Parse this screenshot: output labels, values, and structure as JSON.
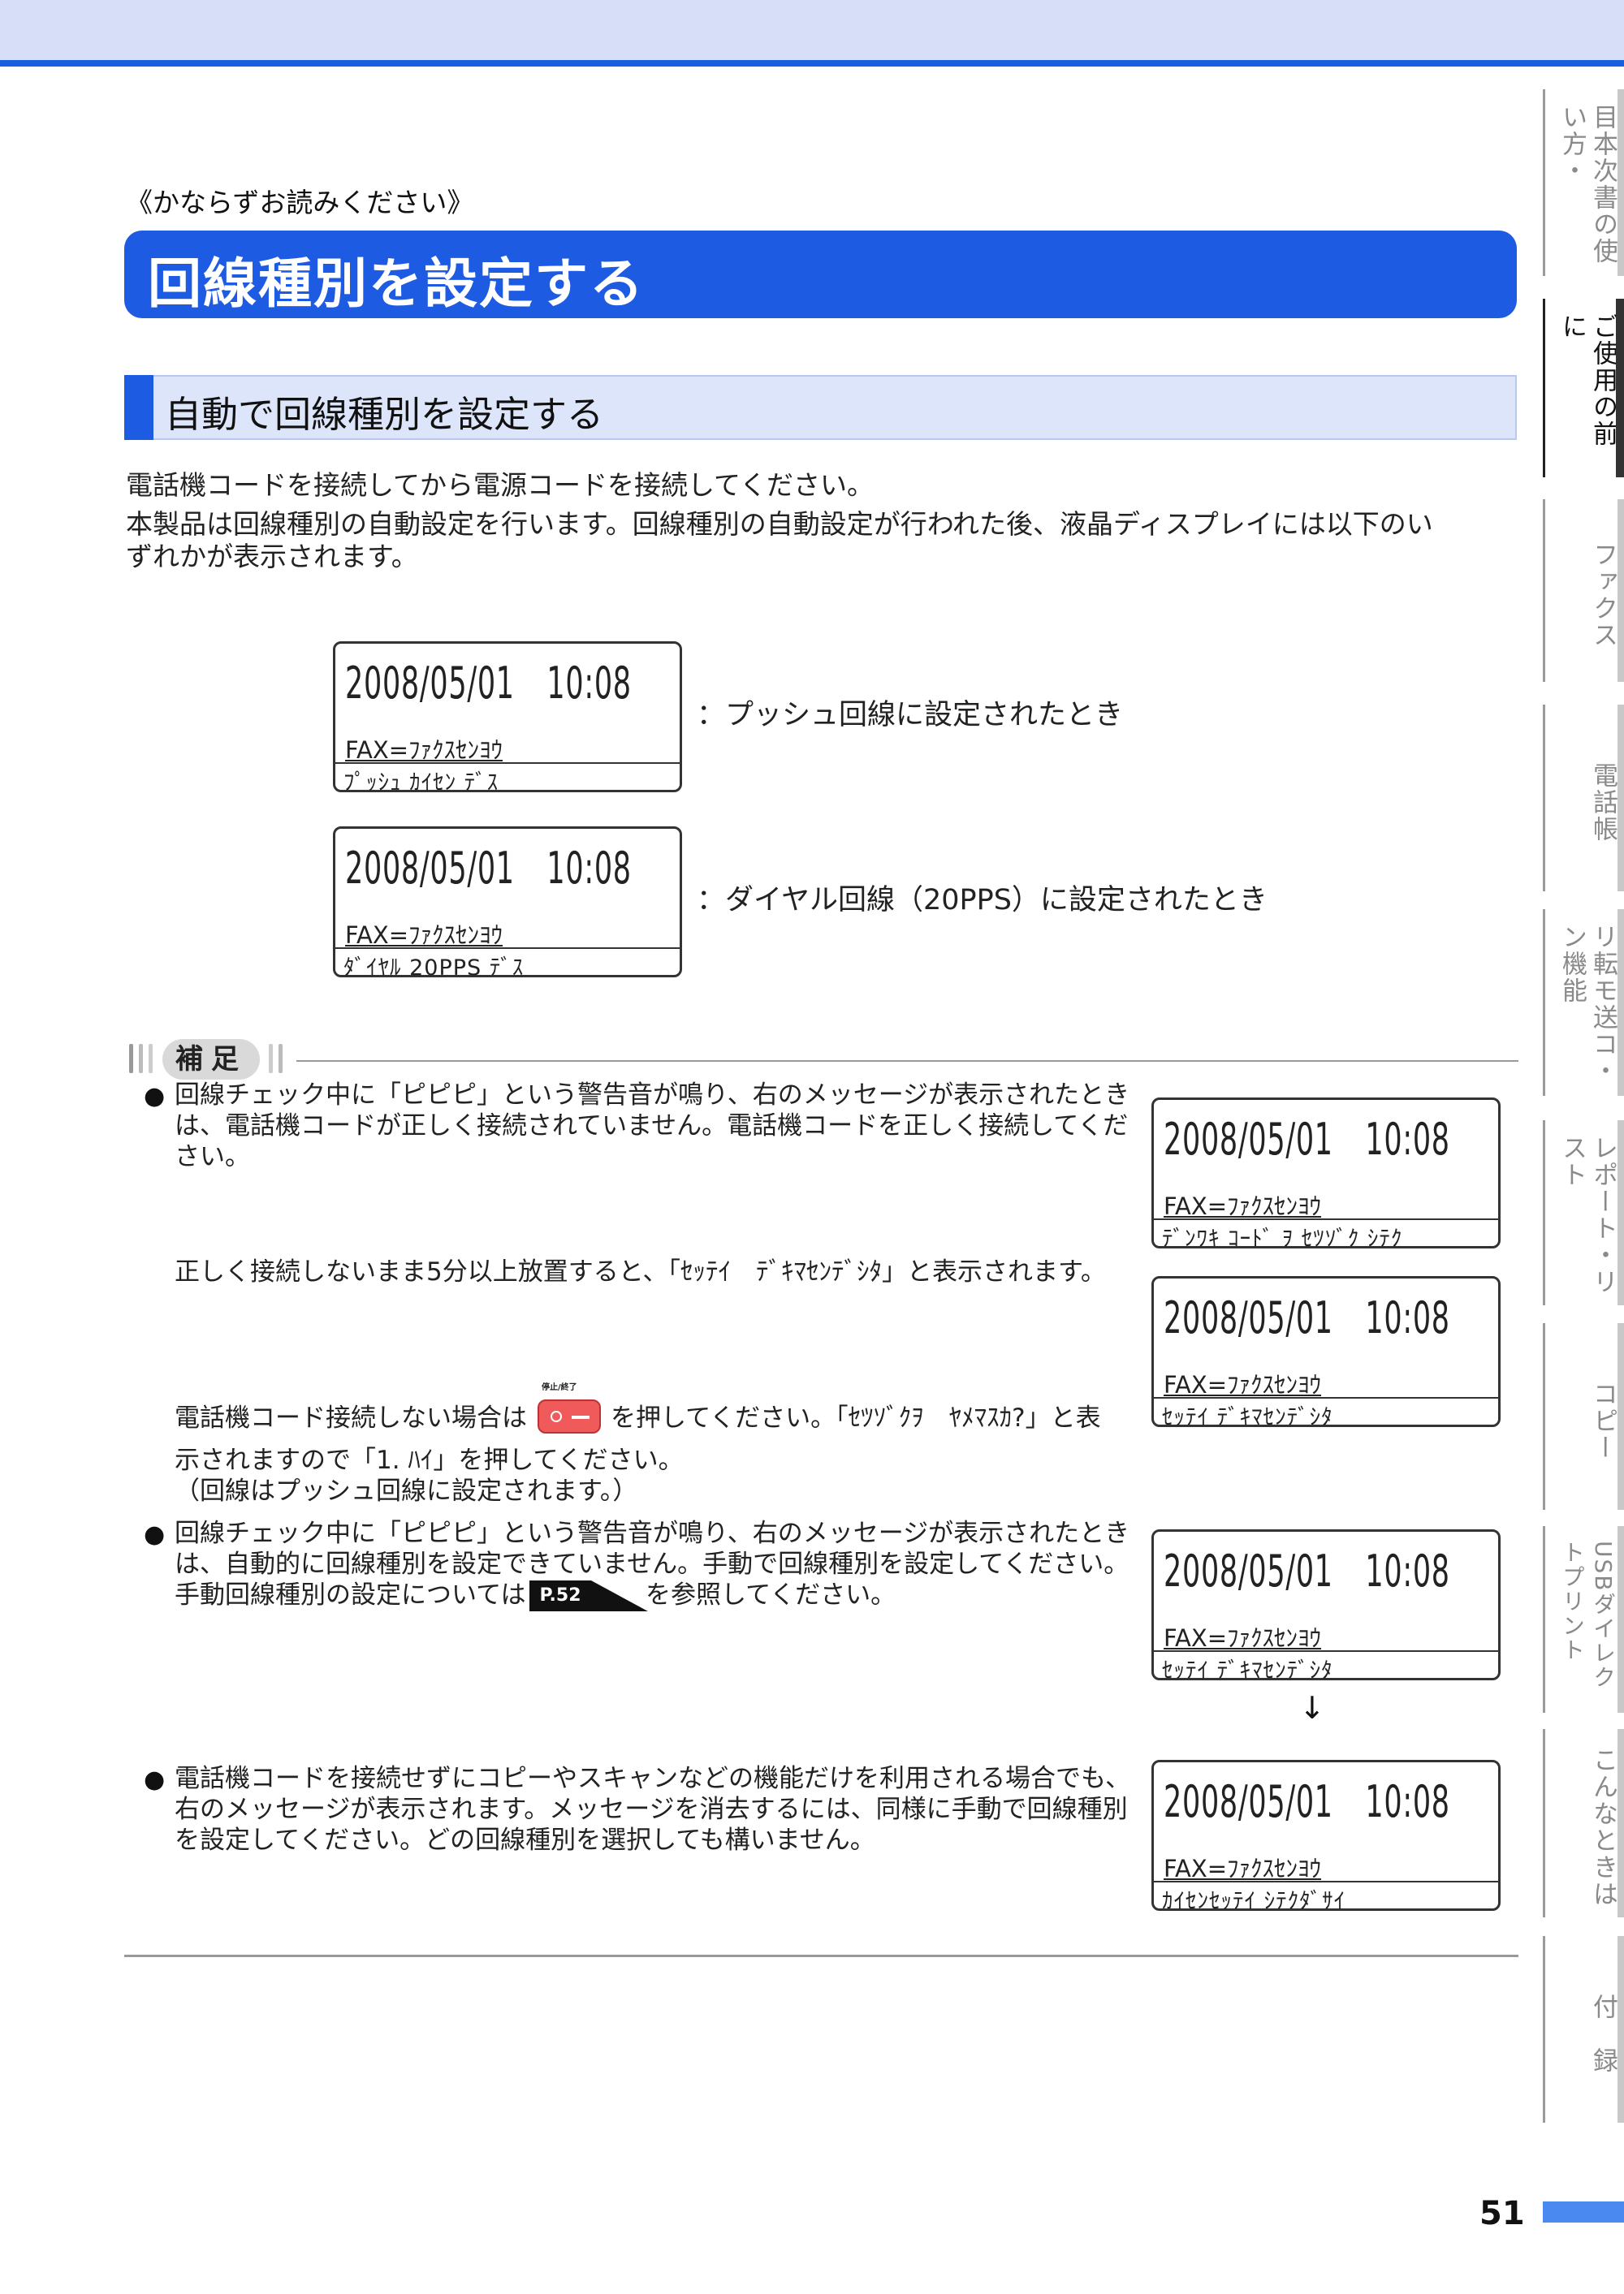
{
  "header": {
    "subtitle": "《かならずお読みください》",
    "title": "回線種別を設定する"
  },
  "section": {
    "heading": "自動で回線種別を設定する",
    "intro": [
      "電話機コードを接続してから電源コードを接続してください。",
      "本製品は回線種別の自動設定を行います。回線種別の自動設定が行われた後、液晶ディスプレイには以下のい",
      "ずれかが表示されます。"
    ]
  },
  "lcd_examples": [
    {
      "line1": "2008/05/01　10:08",
      "line2": "FAX=ﾌｧｸｽｾﾝﾖｳ",
      "line3": "ﾌﾟｯｼｭ ｶｲｾﾝ ﾃﾞｽ",
      "caption": "：プッシュ回線に設定されたとき"
    },
    {
      "line1": "2008/05/01　10:08",
      "line2": "FAX=ﾌｧｸｽｾﾝﾖｳ",
      "line3": "ﾀﾞｲﾔﾙ 20PPS ﾃﾞｽ",
      "caption": "：ダイヤル回線（20PPS）に設定されたとき"
    }
  ],
  "note": {
    "label": "補足",
    "bullet_symbol": "●",
    "item1": {
      "lines": [
        "回線チェック中に「ピピピ」という警告音が鳴り、右のメッセージが表示されたとき",
        "は、電話機コードが正しく接続されていません。電話機コードを正しく接続してくだ",
        "さい。"
      ],
      "follow1": "正しく接続しないまま5分以上放置すると、「ｾｯﾃｲ　ﾃﾞｷﾏｾﾝﾃﾞｼﾀ」と表示されます。",
      "follow2_pre": "電話機コード接続しない場合は",
      "stop_button_label": "停止/終了",
      "follow2_post": "を押してください。「ｾﾂｿﾞｸｦ　ﾔﾒﾏｽｶ?」と表",
      "follow3": "示されますので「1. ﾊｲ」を押してください。",
      "follow4": "（回線はプッシュ回線に設定されます。）"
    },
    "item2": {
      "lines": [
        "回線チェック中に「ピピピ」という警告音が鳴り、右のメッセージが表示されたとき",
        "は、自動的に回線種別を設定できていません。手動で回線種別を設定してください。"
      ],
      "ref_pre": "手動回線種別の設定については",
      "ref_page": "P.52",
      "ref_post": "を参照してください。"
    },
    "item3": {
      "lines": [
        "電話機コードを接続せずにコピーやスキャンなどの機能だけを利用される場合でも、",
        "右のメッセージが表示されます。メッセージを消去するには、同様に手動で回線種別",
        "を設定してください。どの回線種別を選択しても構いません。"
      ]
    },
    "lcds": [
      {
        "line1": "2008/05/01　10:08",
        "line2": "FAX=ﾌｧｸｽｾﾝﾖｳ",
        "line3": "ﾃﾞﾝﾜｷ ｺｰﾄﾞ ｦ ｾﾂｿﾞｸ ｼﾃｸ"
      },
      {
        "line1": "2008/05/01　10:08",
        "line2": "FAX=ﾌｧｸｽｾﾝﾖｳ",
        "line3": "ｾｯﾃｲ ﾃﾞｷﾏｾﾝﾃﾞｼﾀ"
      },
      {
        "line1": "2008/05/01　10:08",
        "line2": "FAX=ﾌｧｸｽｾﾝﾖｳ",
        "line3": "ｾｯﾃｲ ﾃﾞｷﾏｾﾝﾃﾞｼﾀ"
      },
      {
        "line1": "2008/05/01　10:08",
        "line2": "FAX=ﾌｧｸｽｾﾝﾖｳ",
        "line3": "ｶｲｾﾝｾｯﾃｲ ｼﾃｸﾀﾞｻｲ"
      }
    ],
    "arrow": "↓"
  },
  "side_tabs": [
    {
      "label": "目本次書の使い方・",
      "active": false
    },
    {
      "label": "ご使用の前に",
      "active": true
    },
    {
      "label": "ファクス",
      "active": false
    },
    {
      "label": "電話帳",
      "active": false
    },
    {
      "label": "リ転モ送コ・ン機能",
      "active": false
    },
    {
      "label": "レポート・リスト",
      "active": false
    },
    {
      "label": "コピー",
      "active": false
    },
    {
      "label": "USBダイレクトプリント",
      "active": false
    },
    {
      "label": "こんなときは",
      "active": false
    },
    {
      "label": "付　録",
      "active": false
    }
  ],
  "page_number": "51",
  "colors": {
    "accent": "#1d5be3",
    "band": "#d7def8",
    "section_bg": "#dde5fa"
  }
}
